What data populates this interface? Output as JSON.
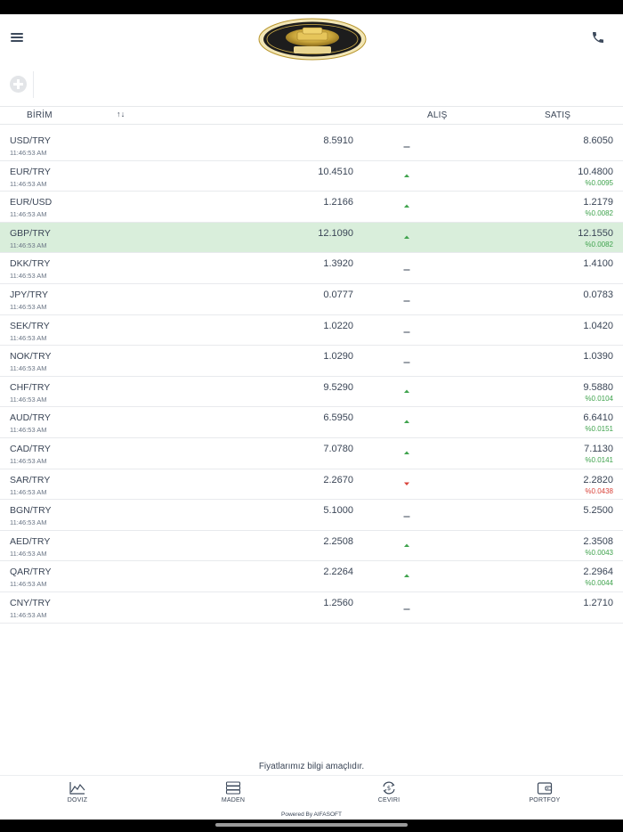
{
  "table": {
    "col_unit": "BİRİM",
    "col_sort": "↑↓",
    "col_buy": "ALIŞ",
    "col_sell": "SATIŞ"
  },
  "rates": [
    {
      "name": "USD/TRY",
      "time": "11:46:53 AM",
      "buy": "8.5910",
      "sell": "8.6050",
      "change": "",
      "trend": "flat"
    },
    {
      "name": "EUR/TRY",
      "time": "11:46:53 AM",
      "buy": "10.4510",
      "sell": "10.4800",
      "change": "%0.0095",
      "trend": "up"
    },
    {
      "name": "EUR/USD",
      "time": "11:46:53 AM",
      "buy": "1.2166",
      "sell": "1.2179",
      "change": "%0.0082",
      "trend": "up"
    },
    {
      "name": "GBP/TRY",
      "time": "11:46:53 AM",
      "buy": "12.1090",
      "sell": "12.1550",
      "change": "%0.0082",
      "trend": "up",
      "highlight": true
    },
    {
      "name": "DKK/TRY",
      "time": "11:46:53 AM",
      "buy": "1.3920",
      "sell": "1.4100",
      "change": "",
      "trend": "flat"
    },
    {
      "name": "JPY/TRY",
      "time": "11:46:53 AM",
      "buy": "0.0777",
      "sell": "0.0783",
      "change": "",
      "trend": "flat"
    },
    {
      "name": "SEK/TRY",
      "time": "11:46:53 AM",
      "buy": "1.0220",
      "sell": "1.0420",
      "change": "",
      "trend": "flat"
    },
    {
      "name": "NOK/TRY",
      "time": "11:46:53 AM",
      "buy": "1.0290",
      "sell": "1.0390",
      "change": "",
      "trend": "flat"
    },
    {
      "name": "CHF/TRY",
      "time": "11:46:53 AM",
      "buy": "9.5290",
      "sell": "9.5880",
      "change": "%0.0104",
      "trend": "up"
    },
    {
      "name": "AUD/TRY",
      "time": "11:46:53 AM",
      "buy": "6.5950",
      "sell": "6.6410",
      "change": "%0.0151",
      "trend": "up"
    },
    {
      "name": "CAD/TRY",
      "time": "11:46:53 AM",
      "buy": "7.0780",
      "sell": "7.1130",
      "change": "%0.0141",
      "trend": "up"
    },
    {
      "name": "SAR/TRY",
      "time": "11:46:53 AM",
      "buy": "2.2670",
      "sell": "2.2820",
      "change": "%0.0438",
      "trend": "down"
    },
    {
      "name": "BGN/TRY",
      "time": "11:46:53 AM",
      "buy": "5.1000",
      "sell": "5.2500",
      "change": "",
      "trend": "flat"
    },
    {
      "name": "AED/TRY",
      "time": "11:46:53 AM",
      "buy": "2.2508",
      "sell": "2.3508",
      "change": "%0.0043",
      "trend": "up"
    },
    {
      "name": "QAR/TRY",
      "time": "11:46:53 AM",
      "buy": "2.2264",
      "sell": "2.2964",
      "change": "%0.0044",
      "trend": "up"
    },
    {
      "name": "CNY/TRY",
      "time": "11:46:53 AM",
      "buy": "1.2560",
      "sell": "1.2710",
      "change": "",
      "trend": "flat"
    }
  ],
  "footer": {
    "disclaimer": "Fiyatlarımız bilgi amaçlıdır.",
    "powered": "Powered By AIFASOFT"
  },
  "nav": [
    {
      "label": "DOVIZ",
      "icon": "chart-line-icon"
    },
    {
      "label": "MADEN",
      "icon": "gold-bars-icon"
    },
    {
      "label": "CEVIRI",
      "icon": "currency-exchange-icon"
    },
    {
      "label": "PORTFOY",
      "icon": "wallet-icon"
    }
  ],
  "colors": {
    "up": "#3fa34d",
    "down": "#d9433a",
    "highlight_row": "#d9eedb",
    "text": "#3a4556"
  }
}
